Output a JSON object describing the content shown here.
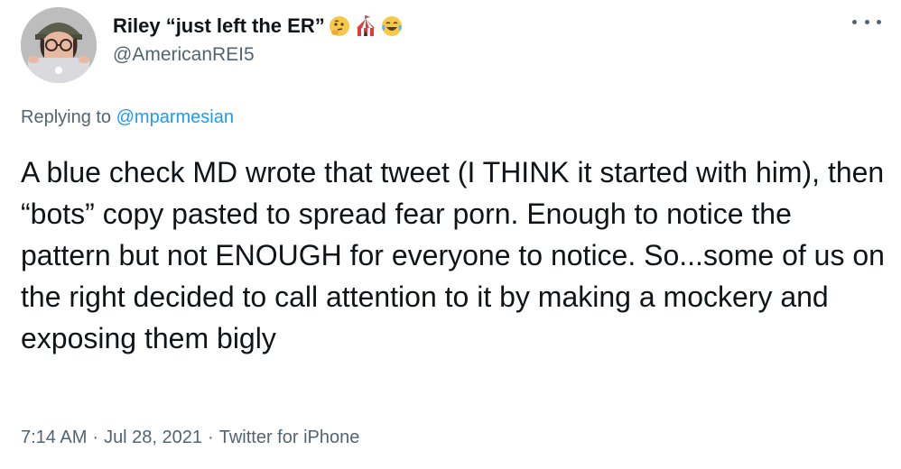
{
  "author": {
    "display_name": "Riley “just left the ER”",
    "emoji_icons": [
      "thinking-face-icon",
      "circus-tent-icon",
      "tears-of-joy-icon"
    ],
    "handle": "@AmericanREI5"
  },
  "reply": {
    "prefix": "Replying to ",
    "mention": "@mparmesian"
  },
  "tweet": {
    "text": "A blue check MD wrote that tweet (I THINK it started with him), then “bots” copy pasted to spread fear porn. Enough to notice the pattern but not ENOUGH for everyone to notice. So...some of us on the right decided to call attention to it by making a mockery and exposing them bigly"
  },
  "meta": {
    "time": "7:14 AM",
    "separator": "·",
    "date": "Jul 28, 2021",
    "source": "Twitter for iPhone"
  },
  "colors": {
    "text": "#0f1419",
    "secondary": "#536471",
    "link": "#1d9bf0"
  }
}
